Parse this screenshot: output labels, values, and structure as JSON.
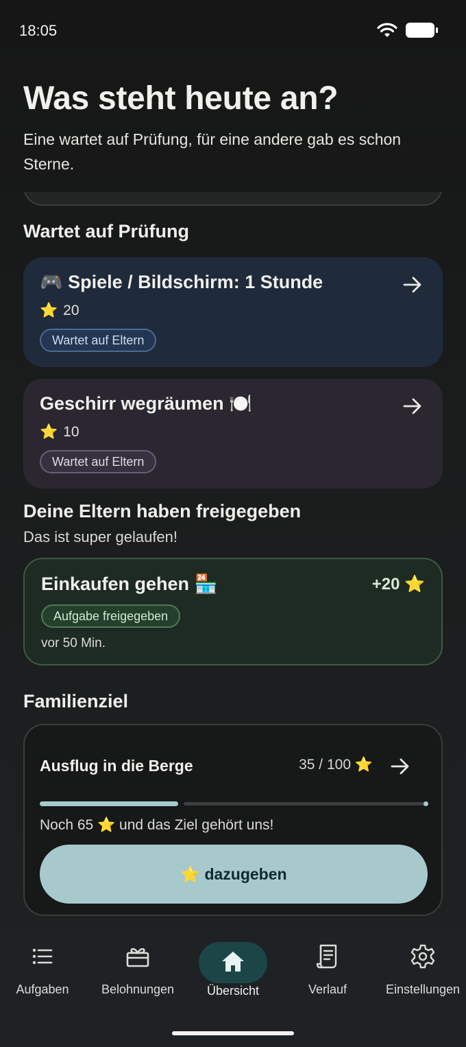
{
  "status": {
    "time": "18:05"
  },
  "header": {
    "title": "Was steht heute an?",
    "subtitle": "Eine wartet auf Prüfung, für eine andere gab es schon Sterne."
  },
  "pending": {
    "title": "Wartet auf Prüfung",
    "items": [
      {
        "title": "🎮 Spiele / Bildschirm: 1 Stunde",
        "stars": "20",
        "badge": "Wartet auf Eltern"
      },
      {
        "title": "Geschirr wegräumen 🍽️",
        "stars": "10",
        "badge": "Wartet auf Eltern"
      }
    ]
  },
  "approved": {
    "title": "Deine Eltern haben freigegeben",
    "subtitle": "Das ist super gelaufen!",
    "item": {
      "title": "Einkaufen gehen 🏪",
      "reward": "+20 ⭐",
      "badge": "Aufgabe freigegeben",
      "time": "vor 50 Min."
    }
  },
  "goal": {
    "section_title": "Familienziel",
    "name": "Ausflug in die Berge",
    "progress_text": "35 / 100 ⭐",
    "current": 35,
    "target": 100,
    "remaining_text": "Noch 65 ⭐ und das Ziel gehört uns!",
    "button_label": "⭐ dazugeben"
  },
  "nav": {
    "items": [
      {
        "label": "Aufgaben",
        "icon": "list-icon"
      },
      {
        "label": "Belohnungen",
        "icon": "gift-icon"
      },
      {
        "label": "Übersicht",
        "icon": "home-icon",
        "active": true
      },
      {
        "label": "Verlauf",
        "icon": "receipt-icon"
      },
      {
        "label": "Einstellungen",
        "icon": "gear-icon"
      }
    ]
  },
  "colors": {
    "accent": "#a7c9cc",
    "pending_card_1": "#1f2a3a",
    "pending_card_2": "#2a2730",
    "approved_card": "#1e2b22"
  }
}
